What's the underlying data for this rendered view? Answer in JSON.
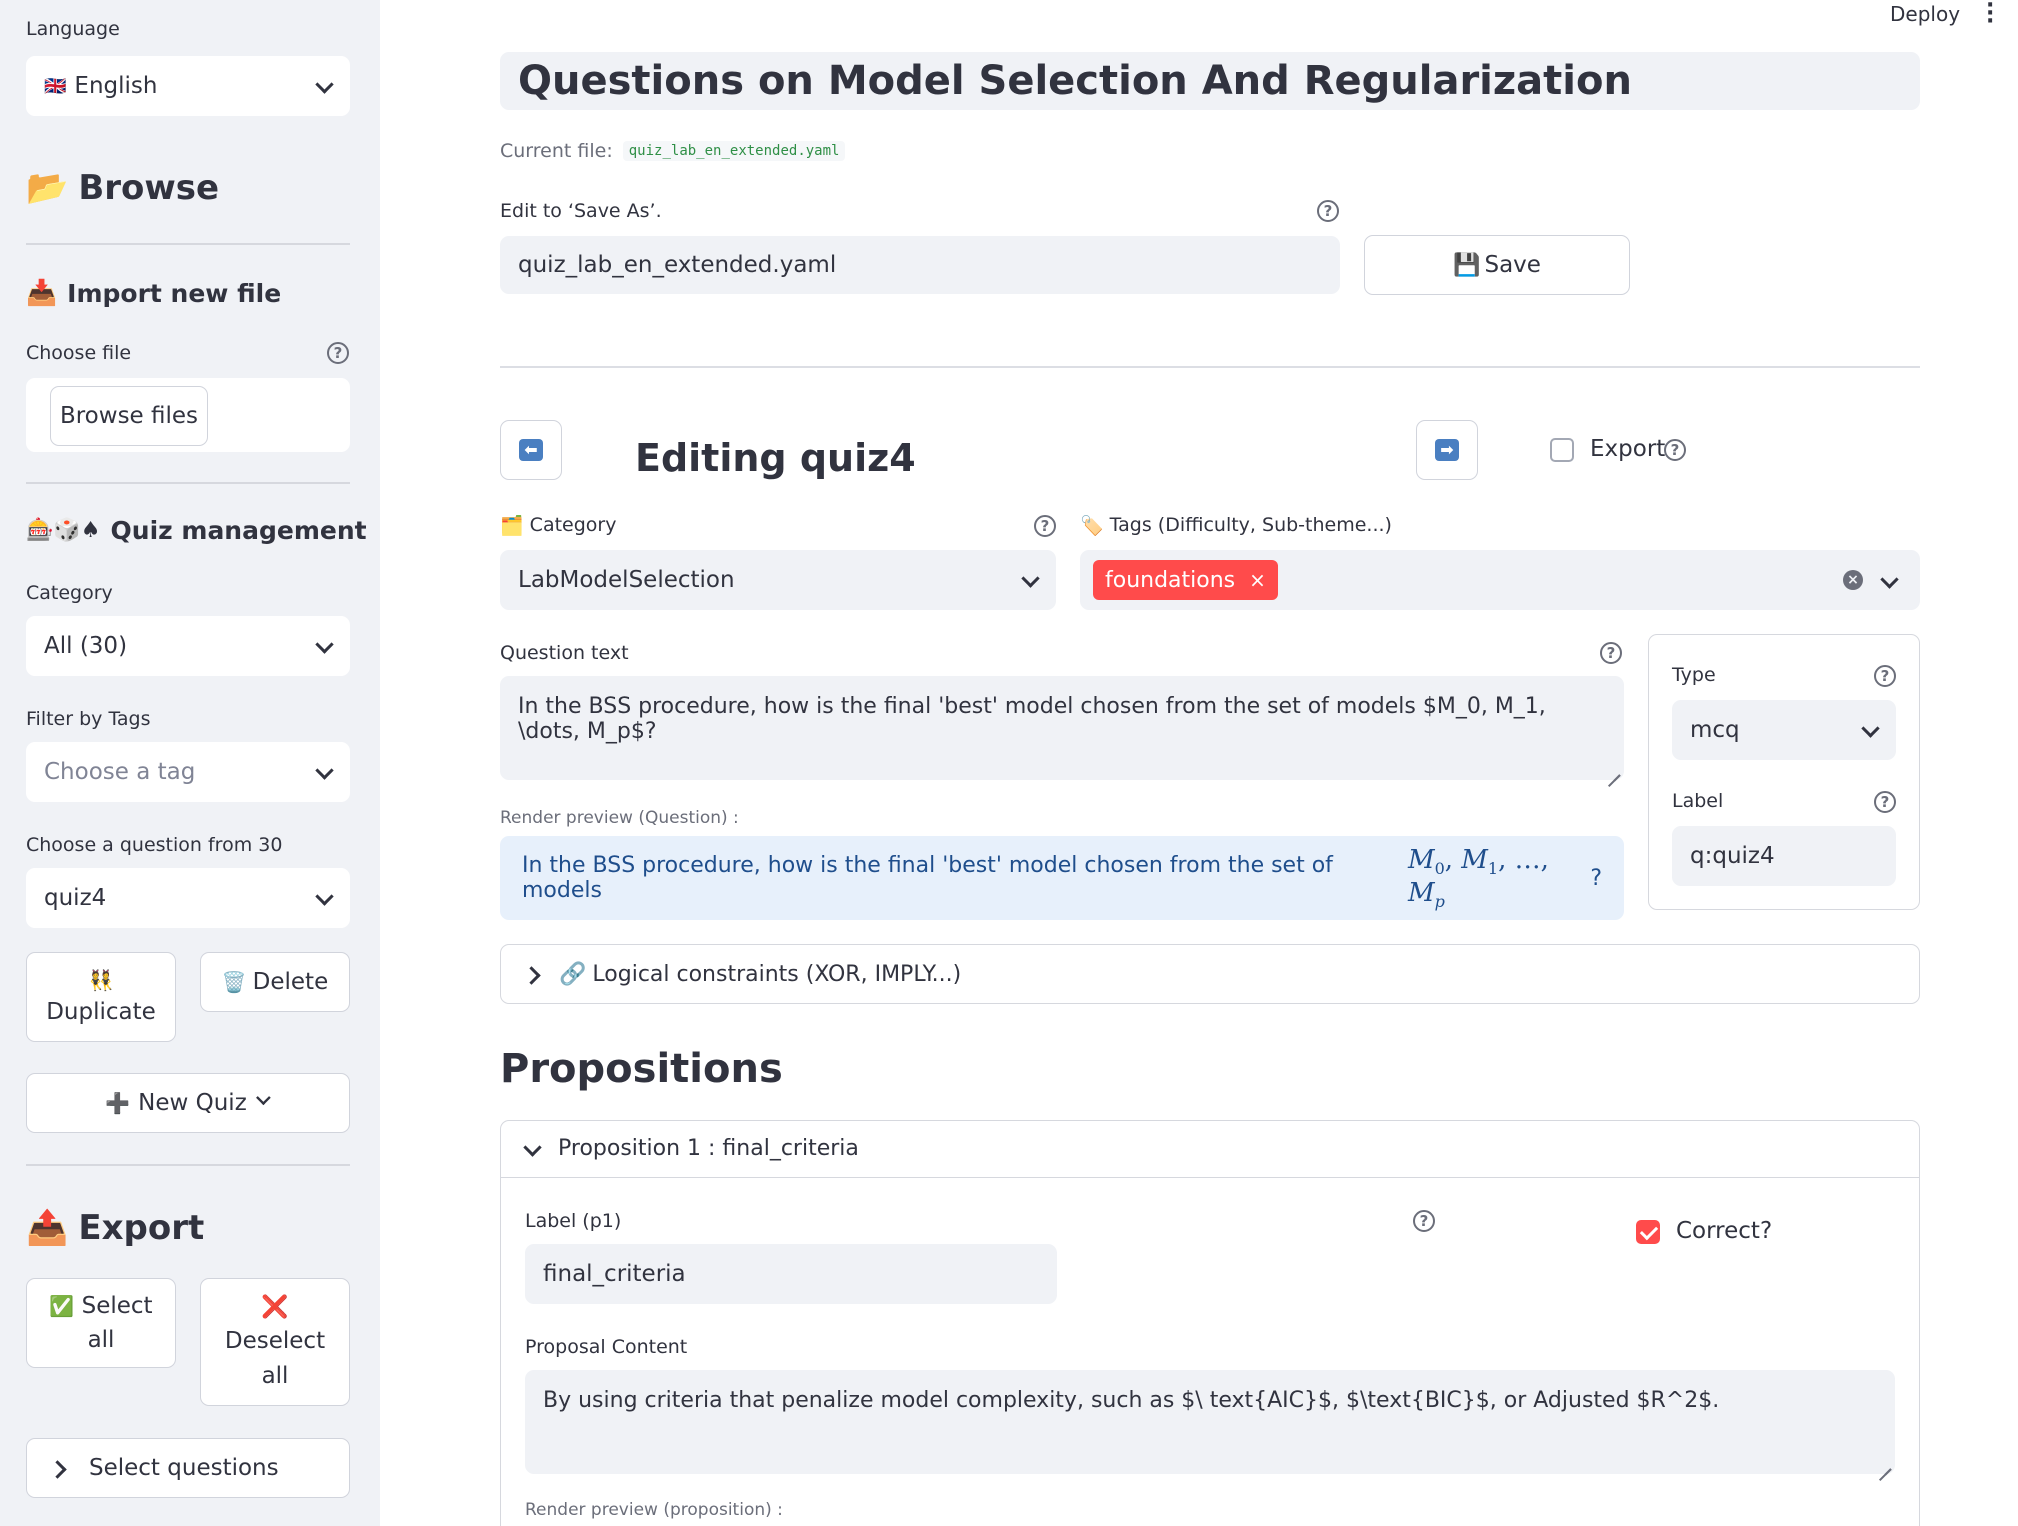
{
  "sidebar": {
    "language": {
      "label": "Language",
      "flag": "🇬🇧",
      "value": "English"
    },
    "browse": {
      "icon": "📂",
      "title": "Browse"
    },
    "import": {
      "icon": "📥",
      "title": "Import new file",
      "choose_label": "Choose file",
      "browse_button": "Browse files"
    },
    "quiz_management": {
      "icons": "🎰🎲♠",
      "title": "Quiz management",
      "category_label": "Category",
      "category_value": "All (30)",
      "tags_label": "Filter by Tags",
      "tags_placeholder": "Choose a tag",
      "question_label": "Choose a question from 30",
      "question_value": "quiz4",
      "duplicate_icon": "👯",
      "duplicate_label": "Duplicate",
      "delete_icon": "🗑️",
      "delete_label": "Delete",
      "new_quiz_icon": "➕",
      "new_quiz_label": "New Quiz"
    },
    "export": {
      "icon": "📤",
      "title": "Export",
      "select_all_icon": "✅",
      "select_all_line1": "Select",
      "select_all_line2": "all",
      "deselect_icon": "❌",
      "deselect_line1": "Deselect",
      "deselect_line2": "all",
      "select_questions": "Select questions"
    }
  },
  "topbar": {
    "deploy": "Deploy"
  },
  "main": {
    "title": "Questions on Model Selection And Regularization",
    "current_file_label": "Current file:",
    "current_file": "quiz_lab_en_extended.yaml",
    "save_as_label": "Edit to ‘Save As’.",
    "save_as_value": "quiz_lab_en_extended.yaml",
    "save_icon": "💾",
    "save_label": "Save",
    "editing_title": "Editing quiz4",
    "export_label": "Export",
    "category_icon": "🗂️",
    "category_label": "Category",
    "category_value": "LabModelSelection",
    "tags_icon": "🏷️",
    "tags_label": "Tags (Difficulty, Sub-theme...)",
    "tag_chip": "foundations",
    "question_text_label": "Question text",
    "question_text": "In the BSS procedure, how is the final 'best' model chosen from the set of models $M_0, M_1, \\dots, M_p$?",
    "render_preview_label": "Render preview (Question) :",
    "preview_text": "In the BSS procedure, how is the final 'best' model chosen from the set of models",
    "preview_math_m": "M",
    "preview_math_sub0": "0",
    "preview_math_sub1": "1",
    "preview_math_subp": "p",
    "preview_math_sep": ",",
    "preview_math_dots": "…",
    "preview_math_end": "?",
    "type_label": "Type",
    "type_value": "mcq",
    "label_label": "Label",
    "label_value": "q:quiz4",
    "constraints_icon": "🔗",
    "constraints_label": "Logical constraints (XOR, IMPLY...)",
    "propositions_title": "Propositions",
    "proposition_header": "Proposition 1 : final_criteria",
    "prop_label_label": "Label (p1)",
    "prop_label_value": "final_criteria",
    "correct_label": "Correct?",
    "proposal_content_label": "Proposal Content",
    "proposal_content": "By using criteria that penalize model complexity, such as $\\ text{AIC}$, $\\text{BIC}$, or Adjusted $R^2$.",
    "render_preview_prop_label": "Render preview (proposition) :"
  }
}
